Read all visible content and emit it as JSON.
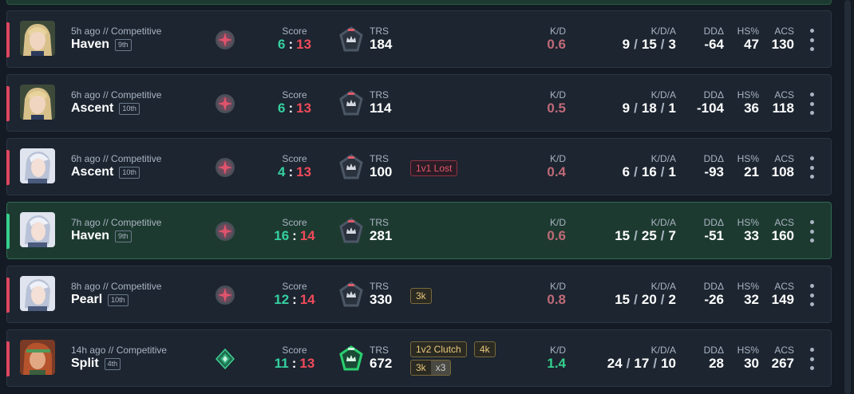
{
  "labels": {
    "score": "Score",
    "trs": "TRS",
    "kd": "K/D",
    "kda": "K/D/A",
    "dd": "DDΔ",
    "hs": "HS%",
    "acs": "ACS",
    "kda_sep": "/",
    "score_sep": ":"
  },
  "colors": {
    "win_accent": "#35d08e",
    "loss_accent": "#e0465f",
    "tag_gold": "#e8c87a",
    "tag_lost": "#e05a6a"
  },
  "matches": [
    {
      "result": "loss",
      "agent": "blonde-agent-portrait",
      "meta": "5h ago // Competitive",
      "map": "Haven",
      "place": "9th",
      "rank_icon": "rank-emblem-icon",
      "score_team": "6",
      "score_enemy": "13",
      "trs": "184",
      "trs_tier": "silver-tier-icon",
      "kd": "0.6",
      "kills": "9",
      "deaths": "15",
      "assists": "3",
      "dd": "-64",
      "hs": "47",
      "acs": "130"
    },
    {
      "result": "loss",
      "agent": "blonde-agent-portrait",
      "meta": "6h ago // Competitive",
      "map": "Ascent",
      "place": "10th",
      "rank_icon": "rank-emblem-icon",
      "score_team": "6",
      "score_enemy": "13",
      "trs": "114",
      "trs_tier": "silver-tier-icon",
      "kd": "0.5",
      "kills": "9",
      "deaths": "18",
      "assists": "1",
      "dd": "-104",
      "hs": "36",
      "acs": "118"
    },
    {
      "result": "loss",
      "agent": "white-hair-agent-portrait",
      "meta": "6h ago // Competitive",
      "map": "Ascent",
      "place": "10th",
      "rank_icon": "rank-emblem-icon",
      "score_team": "4",
      "score_enemy": "13",
      "trs": "100",
      "trs_tier": "silver-tier-icon",
      "tag_lost": "1v1 Lost",
      "kd": "0.4",
      "kills": "6",
      "deaths": "16",
      "assists": "1",
      "dd": "-93",
      "hs": "21",
      "acs": "108"
    },
    {
      "result": "win",
      "agent": "white-hair-agent-portrait",
      "meta": "7h ago // Competitive",
      "map": "Haven",
      "place": "9th",
      "rank_icon": "rank-emblem-icon",
      "score_team": "16",
      "score_enemy": "14",
      "trs": "281",
      "trs_tier": "silver-tier-icon",
      "kd": "0.6",
      "kills": "15",
      "deaths": "25",
      "assists": "7",
      "dd": "-51",
      "hs": "33",
      "acs": "160"
    },
    {
      "result": "loss",
      "agent": "white-hair-agent-portrait",
      "meta": "8h ago // Competitive",
      "map": "Pearl",
      "place": "10th",
      "rank_icon": "rank-emblem-icon",
      "score_team": "12",
      "score_enemy": "14",
      "trs": "330",
      "trs_tier": "silver-tier-icon",
      "tag_gold": "3k",
      "kd": "0.8",
      "kills": "15",
      "deaths": "20",
      "assists": "2",
      "dd": "-26",
      "hs": "32",
      "acs": "149"
    },
    {
      "result": "loss",
      "agent": "red-hair-agent-portrait",
      "meta": "14h ago // Competitive",
      "map": "Split",
      "place": "4th",
      "rank_icon": "ascendant-rank-icon",
      "score_team": "11",
      "score_enemy": "13",
      "trs": "672",
      "trs_tier": "green-tier-icon",
      "tag_clutch": "1v2 Clutch",
      "tag_4k": "4k",
      "tag_3k": "3k",
      "tag_3k_mult": "x3",
      "kd": "1.4",
      "kills": "24",
      "deaths": "17",
      "assists": "10",
      "dd": "28",
      "hs": "30",
      "acs": "267"
    }
  ]
}
